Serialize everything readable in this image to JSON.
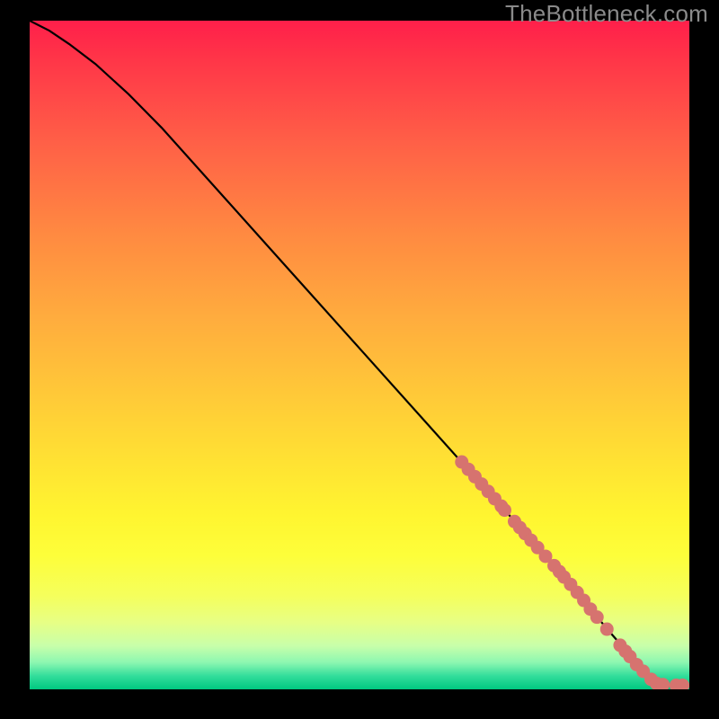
{
  "watermark": "TheBottleneck.com",
  "colors": {
    "background": "#000000",
    "line": "#000000",
    "marker": "#d6736f",
    "gradient_top": "#ff1f4a",
    "gradient_bottom": "#00c880"
  },
  "chart_data": {
    "type": "line",
    "title": "",
    "xlabel": "",
    "ylabel": "",
    "xlim": [
      0,
      100
    ],
    "ylim": [
      0,
      100
    ],
    "grid": false,
    "legend": false,
    "series": [
      {
        "name": "curve",
        "x": [
          0,
          3,
          6,
          10,
          15,
          20,
          30,
          40,
          50,
          60,
          65,
          70,
          75,
          80,
          85,
          88,
          92,
          95,
          97,
          100
        ],
        "y": [
          100,
          98.5,
          96.5,
          93.5,
          89,
          84,
          73,
          62,
          51,
          40,
          34.5,
          29,
          23.5,
          18,
          12,
          8.5,
          4,
          1.2,
          0.6,
          0.6
        ]
      }
    ],
    "markers": [
      {
        "x": 65.5,
        "y": 34.0
      },
      {
        "x": 66.5,
        "y": 32.9
      },
      {
        "x": 67.5,
        "y": 31.8
      },
      {
        "x": 68.5,
        "y": 30.7
      },
      {
        "x": 69.5,
        "y": 29.6
      },
      {
        "x": 70.5,
        "y": 28.5
      },
      {
        "x": 71.5,
        "y": 27.4
      },
      {
        "x": 72.0,
        "y": 26.8
      },
      {
        "x": 73.5,
        "y": 25.1
      },
      {
        "x": 74.3,
        "y": 24.2
      },
      {
        "x": 75.1,
        "y": 23.3
      },
      {
        "x": 76.0,
        "y": 22.3
      },
      {
        "x": 77.0,
        "y": 21.2
      },
      {
        "x": 78.2,
        "y": 19.9
      },
      {
        "x": 79.5,
        "y": 18.5
      },
      {
        "x": 80.3,
        "y": 17.6
      },
      {
        "x": 81.0,
        "y": 16.8
      },
      {
        "x": 82.0,
        "y": 15.7
      },
      {
        "x": 83.0,
        "y": 14.5
      },
      {
        "x": 84.0,
        "y": 13.3
      },
      {
        "x": 85.0,
        "y": 12.0
      },
      {
        "x": 86.0,
        "y": 10.8
      },
      {
        "x": 87.5,
        "y": 9.0
      },
      {
        "x": 89.5,
        "y": 6.6
      },
      {
        "x": 90.3,
        "y": 5.7
      },
      {
        "x": 91.0,
        "y": 4.9
      },
      {
        "x": 92.0,
        "y": 3.7
      },
      {
        "x": 93.0,
        "y": 2.7
      },
      {
        "x": 94.2,
        "y": 1.5
      },
      {
        "x": 95.0,
        "y": 0.9
      },
      {
        "x": 96.0,
        "y": 0.7
      },
      {
        "x": 98.0,
        "y": 0.6
      },
      {
        "x": 99.0,
        "y": 0.6
      }
    ]
  }
}
